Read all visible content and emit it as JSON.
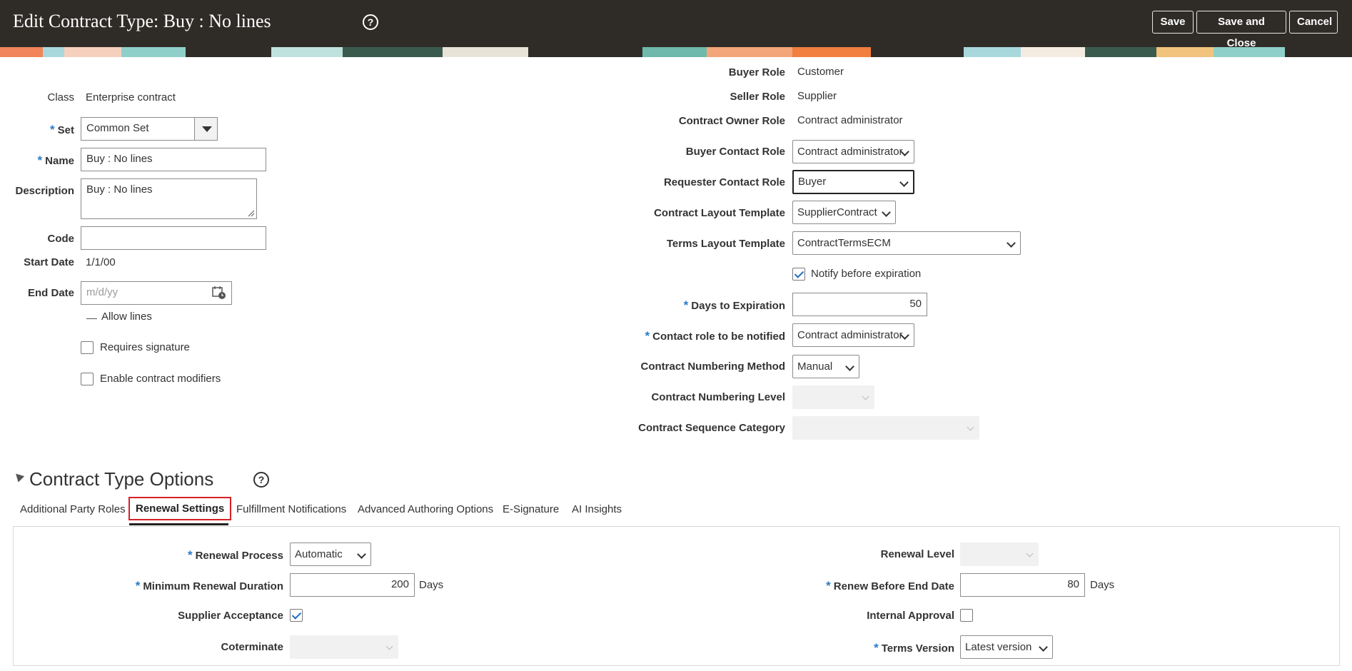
{
  "header": {
    "title": "Edit Contract Type: Buy : No lines",
    "help_glyph": "?",
    "save_label": "Save",
    "save_close_label": "Save and Close",
    "cancel_label": "Cancel",
    "help_icon": "help-circle-icon"
  },
  "left_form": {
    "class_label": "Class",
    "class_value": "Enterprise contract",
    "set_label": "Set",
    "set_value": "Common Set",
    "name_label": "Name",
    "name_value": "Buy : No lines",
    "description_label": "Description",
    "description_value": "Buy : No lines",
    "code_label": "Code",
    "code_value": "",
    "start_date_label": "Start Date",
    "start_date_value": "1/1/00",
    "end_date_label": "End Date",
    "end_date_placeholder": "m/d/yy",
    "allow_lines_label": "Allow lines",
    "requires_signature_label": "Requires signature",
    "requires_signature_checked": false,
    "enable_modifiers_label": "Enable contract modifiers",
    "enable_modifiers_checked": false,
    "required_marker": "*"
  },
  "right_form": {
    "buyer_role_label": "Buyer Role",
    "buyer_role_value": "Customer",
    "seller_role_label": "Seller Role",
    "seller_role_value": "Supplier",
    "owner_role_label": "Contract Owner Role",
    "owner_role_value": "Contract administrator",
    "buyer_contact_label": "Buyer Contact Role",
    "buyer_contact_value": "Contract administrator",
    "requester_contact_label": "Requester Contact Role",
    "requester_contact_value": "Buyer",
    "layout_template_label": "Contract Layout Template",
    "layout_template_value": "SupplierContract",
    "terms_layout_label": "Terms Layout Template",
    "terms_layout_value": "ContractTermsECM",
    "notify_label": "Notify before expiration",
    "notify_checked": true,
    "days_expiration_label": "Days to Expiration",
    "days_expiration_value": "50",
    "contact_notify_label": "Contact role to be notified",
    "contact_notify_value": "Contract administrator",
    "numbering_method_label": "Contract Numbering Method",
    "numbering_method_value": "Manual",
    "numbering_level_label": "Contract Numbering Level",
    "numbering_level_value": "",
    "sequence_category_label": "Contract Sequence Category",
    "sequence_category_value": ""
  },
  "options_section": {
    "title": "Contract Type Options",
    "help_glyph": "?",
    "tabs": [
      {
        "label": "Additional Party Roles",
        "active": false
      },
      {
        "label": "Renewal Settings",
        "active": true
      },
      {
        "label": "Fulfillment Notifications",
        "active": false
      },
      {
        "label": "Advanced Authoring Options",
        "active": false
      },
      {
        "label": "E-Signature",
        "active": false
      },
      {
        "label": "AI Insights",
        "active": false
      }
    ]
  },
  "renewal": {
    "process_label": "Renewal Process",
    "process_value": "Automatic",
    "min_duration_label": "Minimum Renewal Duration",
    "min_duration_value": "200",
    "days_unit": "Days",
    "supplier_acceptance_label": "Supplier Acceptance",
    "supplier_acceptance_checked": true,
    "coterminate_label": "Coterminate",
    "coterminate_value": "",
    "level_label": "Renewal Level",
    "level_value": "",
    "renew_before_label": "Renew Before End Date",
    "renew_before_value": "80",
    "internal_approval_label": "Internal Approval",
    "internal_approval_checked": false,
    "terms_version_label": "Terms Version",
    "terms_version_value": "Latest version"
  },
  "colors": {
    "header_bg": "#2f2c28",
    "required_marker": "#2a7cc7",
    "active_tab_border": "#d62027",
    "checkbox_check": "#1f6fc1"
  }
}
